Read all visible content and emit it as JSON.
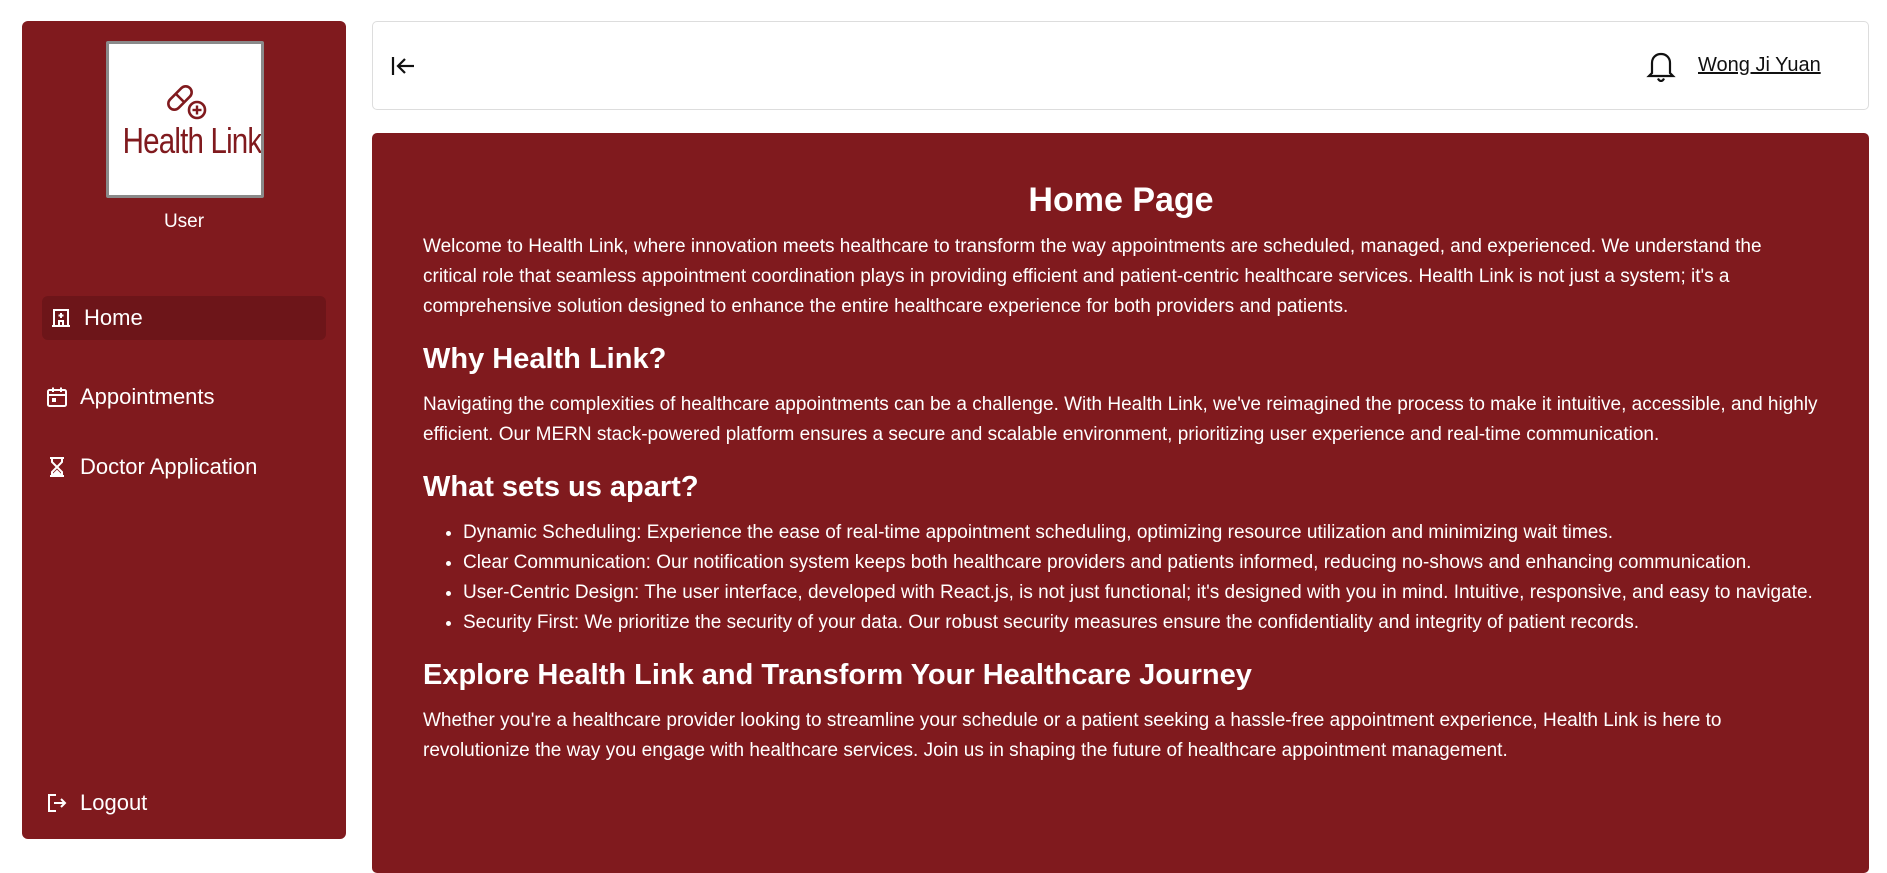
{
  "colors": {
    "brand": "#801a1e",
    "active_nav": "#6d1519",
    "text_on_brand": "#ffffff"
  },
  "sidebar": {
    "logo": {
      "text": "Health Link",
      "icon": "pill-plus-icon"
    },
    "role": "User",
    "items": [
      {
        "label": "Home",
        "icon": "hospital-icon",
        "active": true
      },
      {
        "label": "Appointments",
        "icon": "calendar-icon",
        "active": false
      },
      {
        "label": "Doctor Application",
        "icon": "hourglass-icon",
        "active": false
      }
    ],
    "logout": {
      "label": "Logout",
      "icon": "logout-icon"
    }
  },
  "topbar": {
    "collapse_icon": "collapse-left-icon",
    "bell_icon": "bell-icon",
    "user_name": "Wong Ji Yuan"
  },
  "main": {
    "title": "Home Page",
    "intro": "Welcome to Health Link, where innovation meets healthcare to transform the way appointments are scheduled, managed, and experienced. We understand the critical role that seamless appointment coordination plays in providing efficient and patient-centric healthcare services. Health Link is not just a system; it's a comprehensive solution designed to enhance the entire healthcare experience for both providers and patients.",
    "why_heading": "Why Health Link?",
    "why_text": "Navigating the complexities of healthcare appointments can be a challenge. With Health Link, we've reimagined the process to make it intuitive, accessible, and highly efficient. Our MERN stack-powered platform ensures a secure and scalable environment, prioritizing user experience and real-time communication.",
    "apart_heading": "What sets us apart?",
    "features": [
      "Dynamic Scheduling: Experience the ease of real-time appointment scheduling, optimizing resource utilization and minimizing wait times.",
      "Clear Communication: Our notification system keeps both healthcare providers and patients informed, reducing no-shows and enhancing communication.",
      "User-Centric Design: The user interface, developed with React.js, is not just functional; it's designed with you in mind. Intuitive, responsive, and easy to navigate.",
      "Security First: We prioritize the security of your data. Our robust security measures ensure the confidentiality and integrity of patient records."
    ],
    "explore_heading": "Explore Health Link and Transform Your Healthcare Journey",
    "explore_text": "Whether you're a healthcare provider looking to streamline your schedule or a patient seeking a hassle-free appointment experience, Health Link is here to revolutionize the way you engage with healthcare services. Join us in shaping the future of healthcare appointment management."
  }
}
